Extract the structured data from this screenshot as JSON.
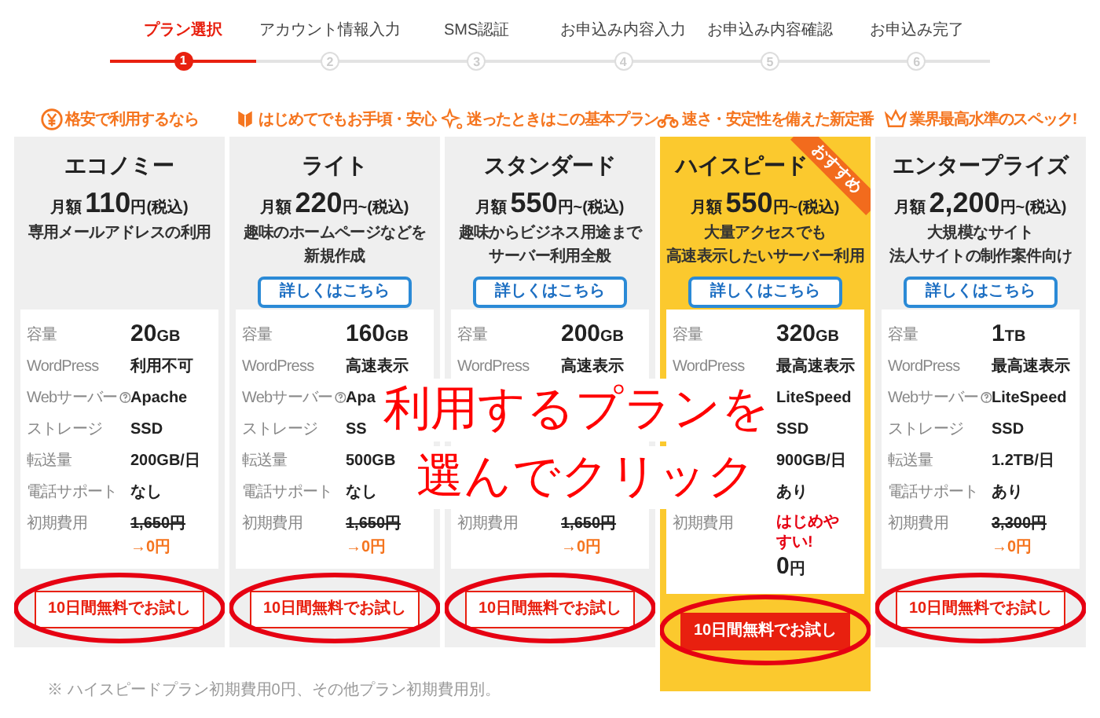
{
  "steps": [
    {
      "label": "プラン選択",
      "number": "1",
      "selected": true
    },
    {
      "label": "アカウント情報入力",
      "number": "2",
      "selected": false
    },
    {
      "label": "SMS認証",
      "number": "3",
      "selected": false
    },
    {
      "label": "お申込み内容入力",
      "number": "4",
      "selected": false
    },
    {
      "label": "お申込み内容確認",
      "number": "5",
      "selected": false
    },
    {
      "label": "お申込み完了",
      "number": "6",
      "selected": false
    }
  ],
  "plans": [
    {
      "tagline": "格安で利用するなら",
      "name": "エコノミー",
      "price_prefix": "月額",
      "price": "110",
      "price_suffix": "円(税込)",
      "description": [
        "専用メールアドレスの利用"
      ],
      "highlighted": false,
      "specs": [
        {
          "label": "容量",
          "value": "20",
          "unit": "GB"
        },
        {
          "label": "WordPress",
          "value": "利用不可"
        },
        {
          "label": "Webサーバー",
          "value": "Apache",
          "help": true
        },
        {
          "label": "ストレージ",
          "value": "SSD"
        },
        {
          "label": "転送量",
          "value": "200GB/日"
        },
        {
          "label": "電話サポート",
          "value": "なし"
        }
      ],
      "fee": {
        "label": "初期費用",
        "kind": "discount",
        "original": "1,650円",
        "discounted": "→0円"
      },
      "trial_button": "10日間無料でお試し"
    },
    {
      "tagline": "はじめてでもお手頃・安心",
      "name": "ライト",
      "price_prefix": "月額",
      "price": "220",
      "price_suffix": "円~(税込)",
      "description": [
        "趣味のホームページなどを",
        "新規作成"
      ],
      "details_button": "詳しくはこちら",
      "highlighted": false,
      "specs": [
        {
          "label": "容量",
          "value": "160",
          "unit": "GB"
        },
        {
          "label": "WordPress",
          "value": "高速表示"
        },
        {
          "label": "Webサーバー",
          "value": "Apa",
          "help": true
        },
        {
          "label": "ストレージ",
          "value": "SS"
        },
        {
          "label": "転送量",
          "value": "500GB"
        },
        {
          "label": "電話サポート",
          "value": "なし"
        }
      ],
      "fee": {
        "label": "初期費用",
        "kind": "discount",
        "original": "1,650円",
        "discounted": "→0円"
      },
      "trial_button": "10日間無料でお試し"
    },
    {
      "tagline": "迷ったときはこの基本プラン",
      "name": "スタンダード",
      "price_prefix": "月額",
      "price": "550",
      "price_suffix": "円~(税込)",
      "description": [
        "趣味からビジネス用途まで",
        "サーバー利用全般"
      ],
      "details_button": "詳しくはこちら",
      "highlighted": false,
      "specs": [
        {
          "label": "容量",
          "value": "200",
          "unit": "GB"
        },
        {
          "label": "WordPress",
          "value": "高速表示"
        }
      ],
      "fee": {
        "label": "初期費用",
        "kind": "discount",
        "original": "1,650円",
        "discounted": "→0円"
      },
      "trial_button": "10日間無料でお試し"
    },
    {
      "tagline": "速さ・安定性を備えた新定番",
      "name": "ハイスピード",
      "badge": "おすすめ",
      "price_prefix": "月額",
      "price": "550",
      "price_suffix": "円~(税込)",
      "description": [
        "大量アクセスでも",
        "高速表示したいサーバー利用"
      ],
      "details_button": "詳しくはこちら",
      "highlighted": true,
      "specs": [
        {
          "label": "容量",
          "value": "320",
          "unit": "GB"
        },
        {
          "label": "WordPress",
          "value": "最高速表示"
        },
        {
          "value": "LiteSpeed"
        },
        {
          "value": "SSD"
        },
        {
          "value": "900GB/日"
        },
        {
          "value": "あり"
        }
      ],
      "fee": {
        "label": "初期費用",
        "kind": "campaign",
        "note": "はじめやすい!",
        "price": "0",
        "unit": "円"
      },
      "trial_button": "10日間無料でお試し"
    },
    {
      "tagline": "業界最高水準のスペック!",
      "name": "エンタープライズ",
      "price_prefix": "月額",
      "price": "2,200",
      "price_suffix": "円~(税込)",
      "description": [
        "大規模なサイト",
        "法人サイトの制作案件向け"
      ],
      "details_button": "詳しくはこちら",
      "highlighted": false,
      "specs": [
        {
          "label": "容量",
          "value": "1",
          "unit": "TB"
        },
        {
          "label": "WordPress",
          "value": "最高速表示"
        },
        {
          "label": "Webサーバー",
          "value": "LiteSpeed",
          "help": true
        },
        {
          "label": "ストレージ",
          "value": "SSD"
        },
        {
          "label": "転送量",
          "value": "1.2TB/日"
        },
        {
          "label": "電話サポート",
          "value": "あり"
        }
      ],
      "fee": {
        "label": "初期費用",
        "kind": "discount",
        "original": "3,300円",
        "discounted": "→0円"
      },
      "trial_button": "10日間無料でお試し"
    }
  ],
  "footnote": "※ ハイスピードプラン初期費用0円、その他プラン初期費用別。",
  "annotation": [
    "利用するプランを",
    "選んでクリック"
  ]
}
